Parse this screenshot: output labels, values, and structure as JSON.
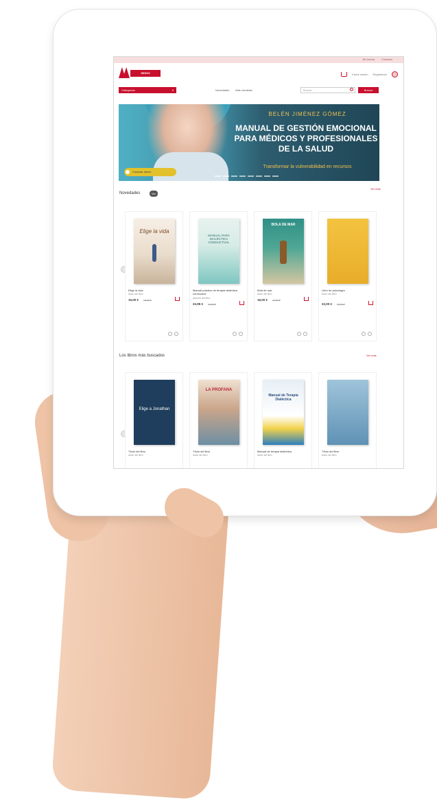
{
  "page": {
    "topbar": {
      "link1": "Mi cuenta",
      "link2": "Contacto"
    },
    "header": {
      "logo_text": "SEDICI",
      "account_label": "Iniciar sesión",
      "register_label": "Registrarse"
    },
    "nav": {
      "categories_label": "Categorías",
      "categories_arrow": "▾",
      "link_novedades": "Novedades",
      "link_mas_vendidos": "Más vendidos",
      "search_placeholder": "Buscar...",
      "search_button": "Buscar"
    },
    "banner": {
      "author": "BELÉN JIMÉNEZ GÓMEZ",
      "title": "MANUAL DE GESTIÓN EMOCIONAL PARA MÉDICOS Y PROFESIONALES DE LA SALUD",
      "subtitle": "Transformar la vulnerabilidad en recursos",
      "cta": "Comprar ahora"
    },
    "sections": {
      "novedades": {
        "title": "Novedades",
        "badge": "Ver",
        "see_all": "Ver más"
      },
      "buscados": {
        "title": "Los libros más buscados",
        "see_all": "Ver más"
      }
    },
    "row1": [
      {
        "cover_line1": "Elige la vida",
        "title": "Elige la vida",
        "author": "Autor del libro",
        "price": "15,00 €",
        "old_price": "16,00 €"
      },
      {
        "cover_line1": "MANUAL PARA DIALÉCTICA CONDUCTUAL",
        "title": "Manual práctico de terapia dialéctica conductual",
        "author": "Autores del libro",
        "price": "22,95 €",
        "old_price": "24,00 €"
      },
      {
        "cover_line1": "BOLA DE MAR",
        "title": "Bola de mar",
        "author": "Autor del libro",
        "price": "16,00 €",
        "old_price": "17,00 €"
      },
      {
        "cover_line1": "",
        "title": "Libro de psicología",
        "author": "Autor del libro",
        "price": "22,00 €",
        "old_price": "23,00 €"
      }
    ],
    "row2": [
      {
        "cover_line1": "Elige a Jonathan",
        "title": "Título del libro",
        "author": "Autor del libro"
      },
      {
        "cover_line1": "LA PROFANA",
        "title": "Título del libro",
        "author": "Autor del libro"
      },
      {
        "cover_line1": "Manual de Terapia Dialéctica",
        "title": "Manual de terapia dialéctica",
        "author": "Autor del libro"
      },
      {
        "cover_line1": "",
        "title": "Título del libro",
        "author": "Autor del libro"
      }
    ],
    "colors": {
      "brand": "#c8102e",
      "accent": "#f2c14e"
    }
  }
}
